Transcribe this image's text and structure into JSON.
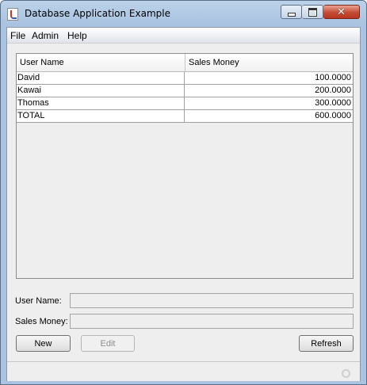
{
  "window": {
    "title": "Database Application Example",
    "icon": "java-coffee-cup-icon",
    "controls": {
      "minimize": "minimize",
      "maximize": "maximize",
      "close": "close"
    }
  },
  "menu": {
    "items": [
      {
        "label": "File"
      },
      {
        "label": "Admin"
      },
      {
        "label": "Help"
      }
    ]
  },
  "table": {
    "columns": [
      "User Name",
      "Sales Money"
    ],
    "rows": [
      {
        "user": "David",
        "sales": "100.0000"
      },
      {
        "user": "Kawai",
        "sales": "200.0000"
      },
      {
        "user": "Thomas",
        "sales": "300.0000"
      },
      {
        "user": "TOTAL",
        "sales": "600.0000"
      }
    ]
  },
  "form": {
    "user_name_label": "User Name:",
    "user_name_value": "",
    "sales_money_label": "Sales Money:",
    "sales_money_value": ""
  },
  "buttons": {
    "new": "New",
    "edit": "Edit",
    "refresh": "Refresh"
  },
  "status": {
    "indicator": "busy-indicator-icon"
  }
}
